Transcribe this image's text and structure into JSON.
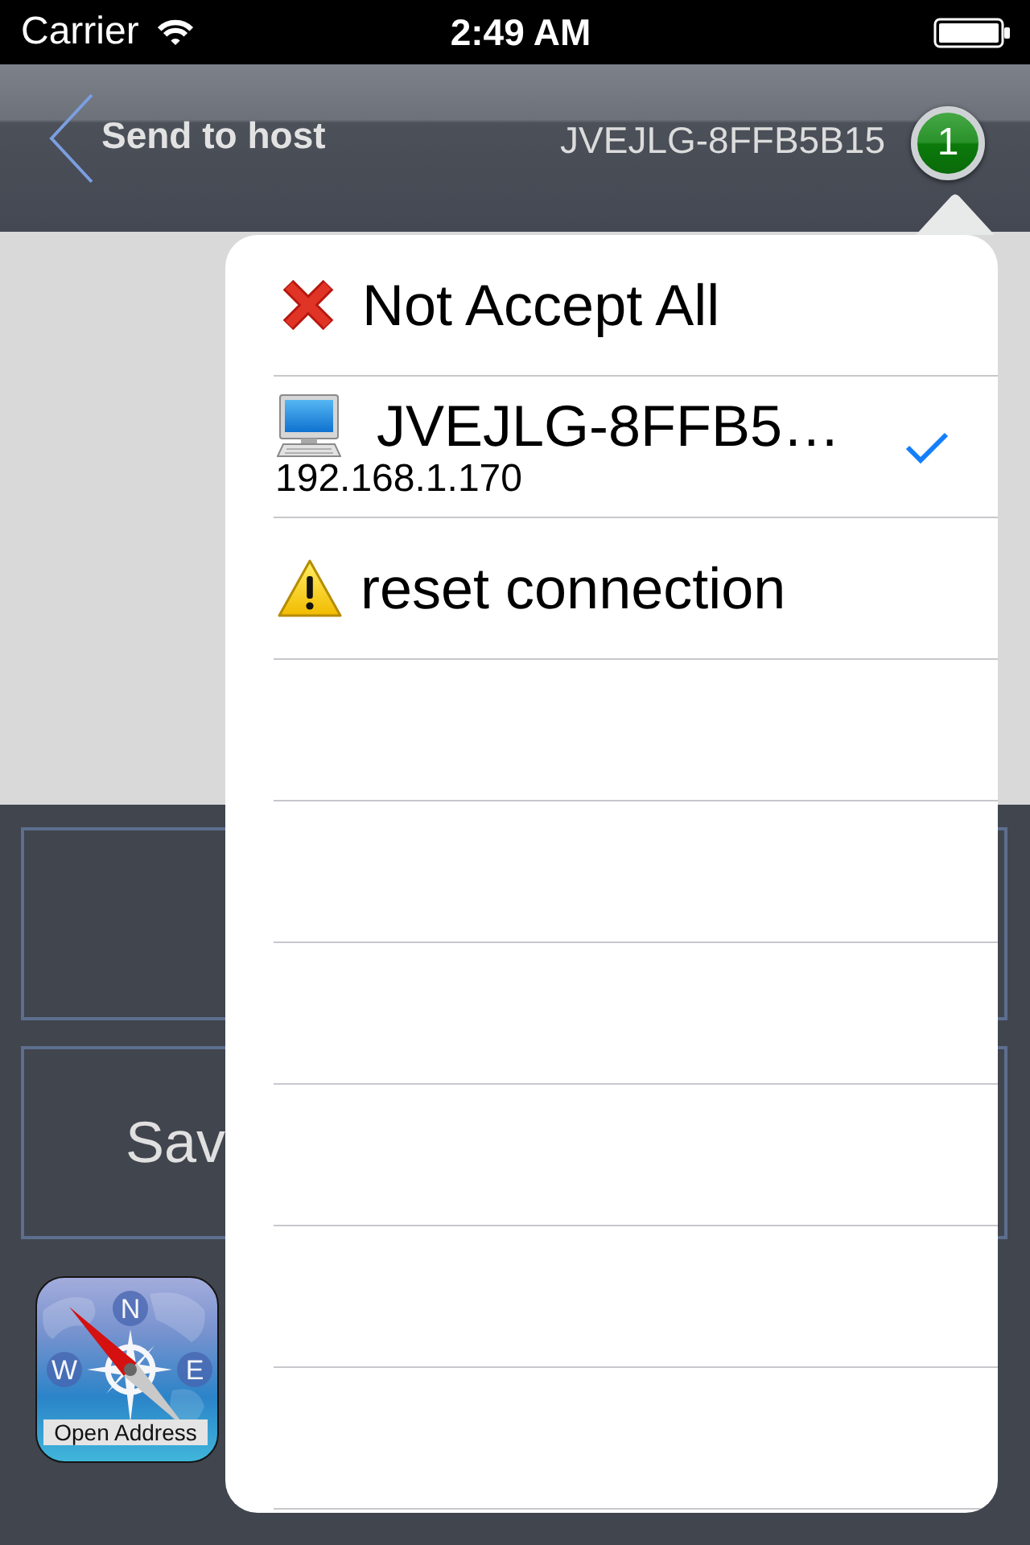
{
  "status_bar": {
    "carrier": "Carrier",
    "time": "2:49 AM"
  },
  "nav_bar": {
    "back_label": "Send to host",
    "title": "JVEJLG-8FFB5B15",
    "badge": "1"
  },
  "buttons": [
    {
      "kind": "blank"
    },
    {
      "kind": "labeled",
      "label": "Sav"
    }
  ],
  "app_icon": {
    "label": "Open Address",
    "compass_letters": [
      {
        "kind": "north",
        "text": "N"
      },
      {
        "kind": "west",
        "text": "W"
      },
      {
        "kind": "east",
        "text": "E"
      }
    ]
  },
  "popover": {
    "items": [
      {
        "kind": "reject",
        "title": "Not Accept All",
        "selected": false
      },
      {
        "kind": "host",
        "title": "JVEJLG-8FFB5…",
        "subtitle": "192.168.1.170",
        "selected": true
      },
      {
        "kind": "warning",
        "title": "reset connection",
        "selected": false
      }
    ]
  }
}
